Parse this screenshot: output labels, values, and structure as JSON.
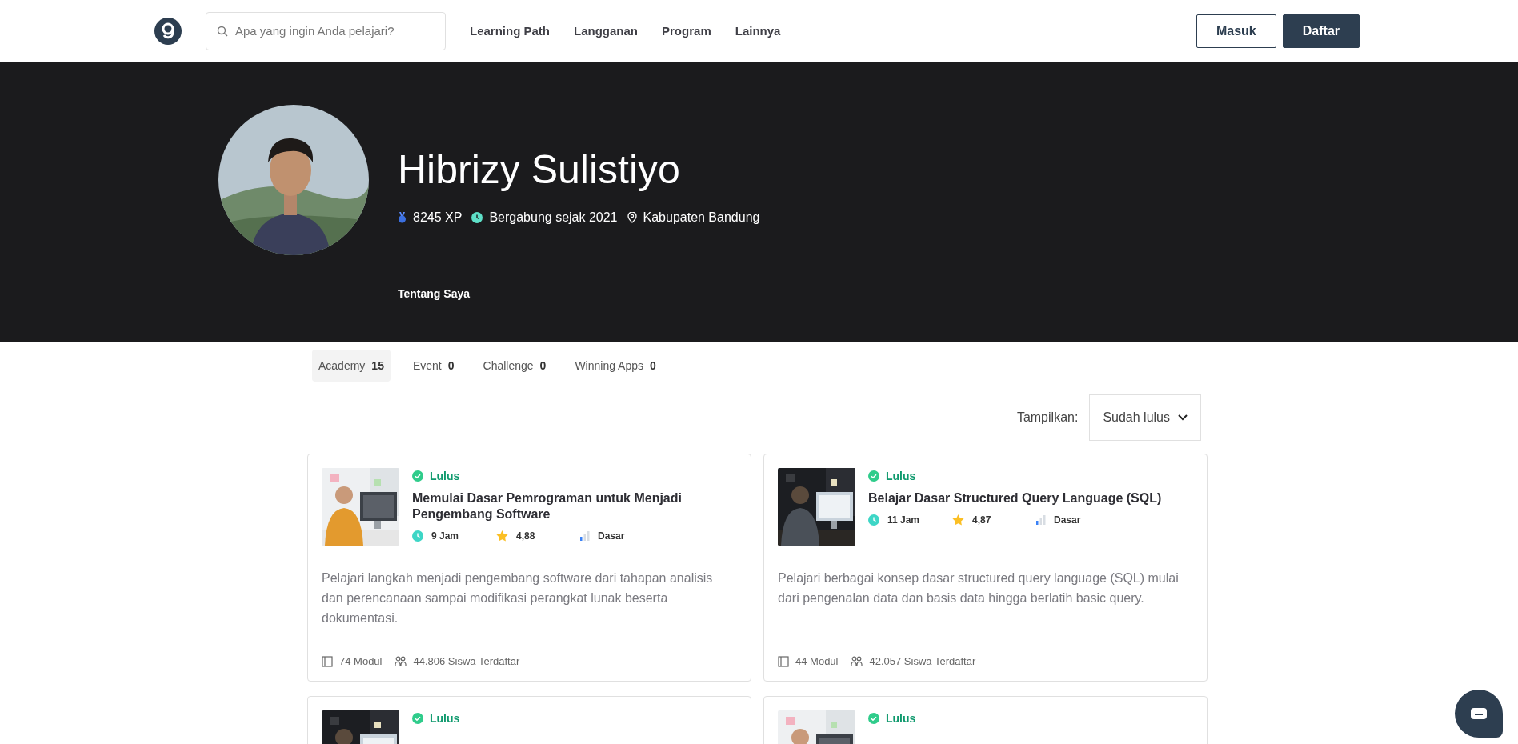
{
  "header": {
    "search": {
      "placeholder": "Apa yang ingin Anda pelajari?"
    },
    "nav": [
      "Learning Path",
      "Langganan",
      "Program",
      "Lainnya"
    ],
    "buttons": [
      {
        "label": "Masuk",
        "kind": "outline"
      },
      {
        "label": "Daftar",
        "kind": "solid"
      }
    ]
  },
  "profile": {
    "name": "Hibrizy Sulistiyo",
    "xp": "8245 XP",
    "joined": "Bergabung sejak 2021",
    "location": "Kabupaten Bandung",
    "about_heading": "Tentang Saya"
  },
  "tabs": [
    {
      "label": "Academy",
      "count": "15",
      "selected": true
    },
    {
      "label": "Event",
      "count": "0",
      "selected": false
    },
    {
      "label": "Challenge",
      "count": "0",
      "selected": false
    },
    {
      "label": "Winning Apps",
      "count": "0",
      "selected": false
    }
  ],
  "filter": {
    "label": "Tampilkan:",
    "value": "Sudah lulus"
  },
  "courses": [
    {
      "status": "Lulus",
      "title": "Memulai Dasar Pemrograman untuk Menjadi Pengembang Software",
      "duration": "9 Jam",
      "rating": "4,88",
      "level": "Dasar",
      "description": "Pelajari langkah menjadi pengembang software dari tahapan analisis dan perencanaan sampai modifikasi perangkat lunak beserta dokumentasi.",
      "modules": "74 Modul",
      "students": "44.806 Siswa Terdaftar"
    },
    {
      "status": "Lulus",
      "title": "Belajar Dasar Structured Query Language (SQL)",
      "duration": "11 Jam",
      "rating": "4,87",
      "level": "Dasar",
      "description": "Pelajari berbagai konsep dasar structured query language (SQL) mulai dari pengenalan data dan basis data hingga berlatih basic query.",
      "modules": "44 Modul",
      "students": "42.057 Siswa Terdaftar"
    },
    {
      "status": "Lulus"
    },
    {
      "status": "Lulus"
    }
  ]
}
